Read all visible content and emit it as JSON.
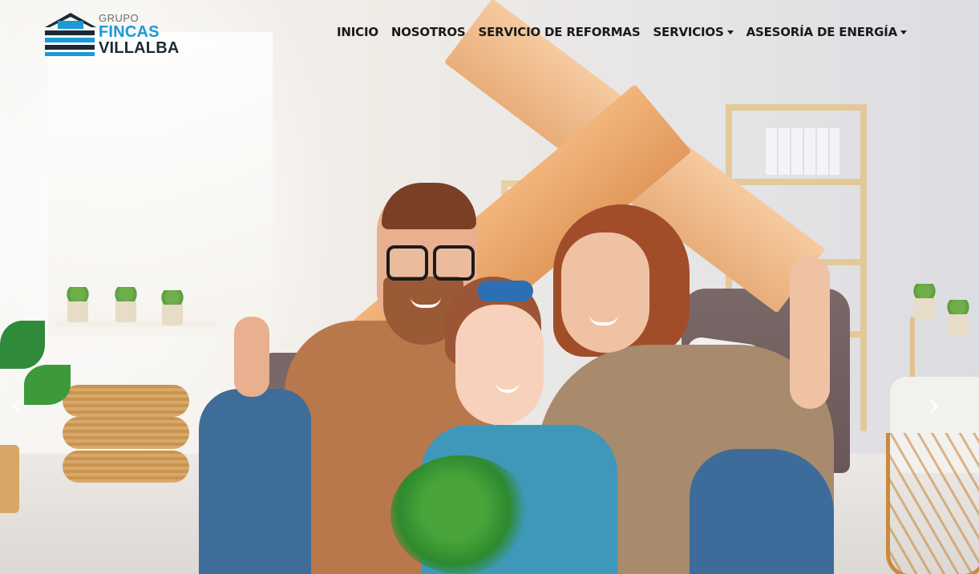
{
  "brand": {
    "line1": "GRUPO",
    "line2": "FINCAS",
    "line3": "VILLALBA",
    "accent_color": "#1a9ad6",
    "dark_color": "#1d2a35"
  },
  "nav": {
    "items": [
      {
        "label": "INICIO",
        "dropdown": false
      },
      {
        "label": "NOSOTROS",
        "dropdown": false
      },
      {
        "label": "SERVICIO DE REFORMAS",
        "dropdown": false
      },
      {
        "label": "SERVICIOS",
        "dropdown": true
      },
      {
        "label": "ASESORÍA DE ENERGÍA",
        "dropdown": true
      }
    ]
  },
  "carousel": {
    "prev_icon": "chevron-left-icon",
    "next_icon": "chevron-right-icon"
  }
}
